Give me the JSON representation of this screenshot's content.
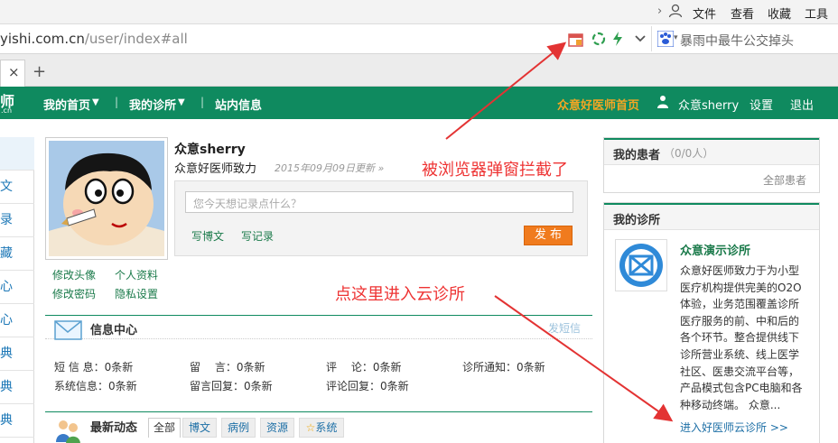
{
  "browser": {
    "menu": [
      "文件",
      "查看",
      "收藏",
      "工具"
    ],
    "url_host": "yishi.com.cn",
    "url_path": "/user/index#all",
    "search_text": "暴雨中最牛公交掉头",
    "tab_close": "×",
    "tab_new": "+"
  },
  "nav": {
    "logo_line1": "师",
    "logo_line2": ".cn",
    "items": [
      "我的首页",
      "我的诊所",
      "站内信息"
    ],
    "right_home": "众意好医师首页",
    "user": "众意sherry",
    "settings": "设置",
    "logout": "退出",
    "separator": "|",
    "caret": "▼"
  },
  "left_sidebar": [
    "文",
    "录",
    "藏",
    "心",
    "心",
    "典",
    "典",
    "典"
  ],
  "profile": {
    "name": "众意sherry",
    "title": "众意好医师致力",
    "updated": "2015年09月09日更新 »",
    "placeholder": "您今天想记录点什么？",
    "write_article": "写博文",
    "write_record": "写记录",
    "publish": "发 布",
    "links": [
      "修改头像",
      "个人资料",
      "修改密码",
      "隐私设置"
    ]
  },
  "info_center": {
    "title": "信息中心",
    "send": "发短信",
    "rows": [
      [
        "短 信 息：0条新",
        "留　 言：0条新",
        "评　 论：0条新",
        "诊所通知：0条新"
      ],
      [
        "系统信息：0条新",
        "留言回复：0条新",
        "评论回复：0条新"
      ]
    ]
  },
  "news": {
    "title": "最新动态",
    "tabs": [
      "全部",
      "博文",
      "病例",
      "资源",
      "系统"
    ]
  },
  "patients": {
    "title": "我的患者",
    "count": "（0/0人）",
    "all": "全部患者"
  },
  "clinic": {
    "title": "我的诊所",
    "name": "众意演示诊所",
    "desc": "众意好医师致力于为小型医疗机构提供完美的O2O体验，业务范围覆盖诊所医疗服务的前、中和后的各个环节。整合提供线下诊所营业系统、线上医学社区、医患交流平台等，产品模式包含PC电脑和各种移动终端。 众意...",
    "enter": "进入好医师云诊所 >>"
  },
  "annotations": {
    "popup_blocked": "被浏览器弹窗拦截了",
    "click_here": "点这里进入云诊所"
  },
  "colors": {
    "nav_green": "#0f8a5f",
    "accent_orange": "#f07b1e",
    "annotation_red": "#e33333",
    "link_blue": "#1d6fa6"
  }
}
